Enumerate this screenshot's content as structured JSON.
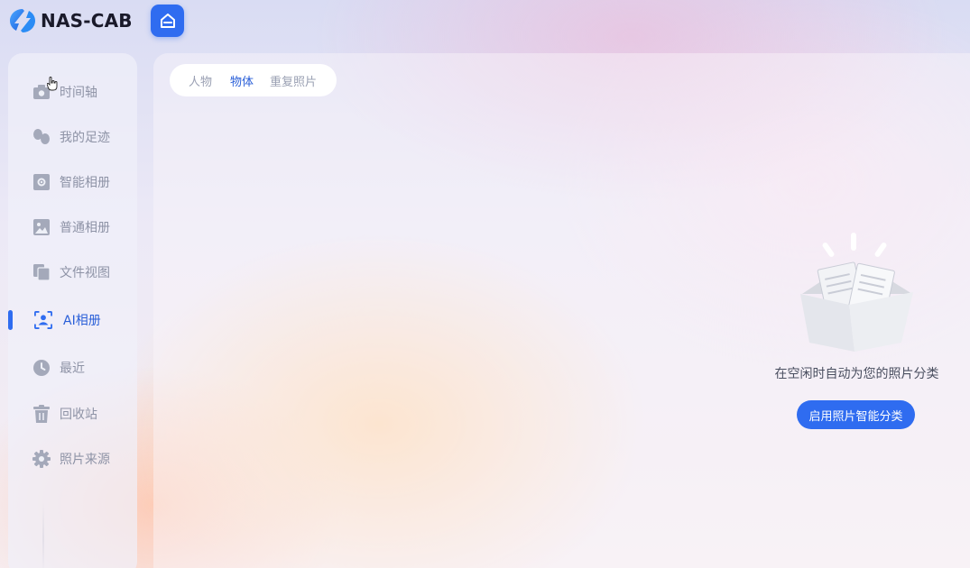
{
  "app": {
    "name": "NAS-CAB",
    "accent_color": "#2f6cf0"
  },
  "header": {
    "home_icon": "home-icon"
  },
  "sidebar": {
    "items": [
      {
        "label": "时间轴",
        "icon": "camera-icon"
      },
      {
        "label": "我的足迹",
        "icon": "footprints-icon"
      },
      {
        "label": "智能相册",
        "icon": "smart-album-icon"
      },
      {
        "label": "普通相册",
        "icon": "image-icon"
      },
      {
        "label": "文件视图",
        "icon": "files-icon"
      },
      {
        "label": "AI相册",
        "icon": "person-scan-icon",
        "active": true
      },
      {
        "label": "最近",
        "icon": "clock-icon"
      },
      {
        "label": "回收站",
        "icon": "trash-icon"
      },
      {
        "label": "照片来源",
        "icon": "gear-icon"
      }
    ]
  },
  "main": {
    "tabs": [
      {
        "label": "人物"
      },
      {
        "label": "物体",
        "active": true
      },
      {
        "label": "重复照片"
      }
    ],
    "empty_state": {
      "message": "在空闲时自动为您的照片分类",
      "button_label": "启用照片智能分类",
      "illustration": "open-box-documents-illustration"
    }
  }
}
